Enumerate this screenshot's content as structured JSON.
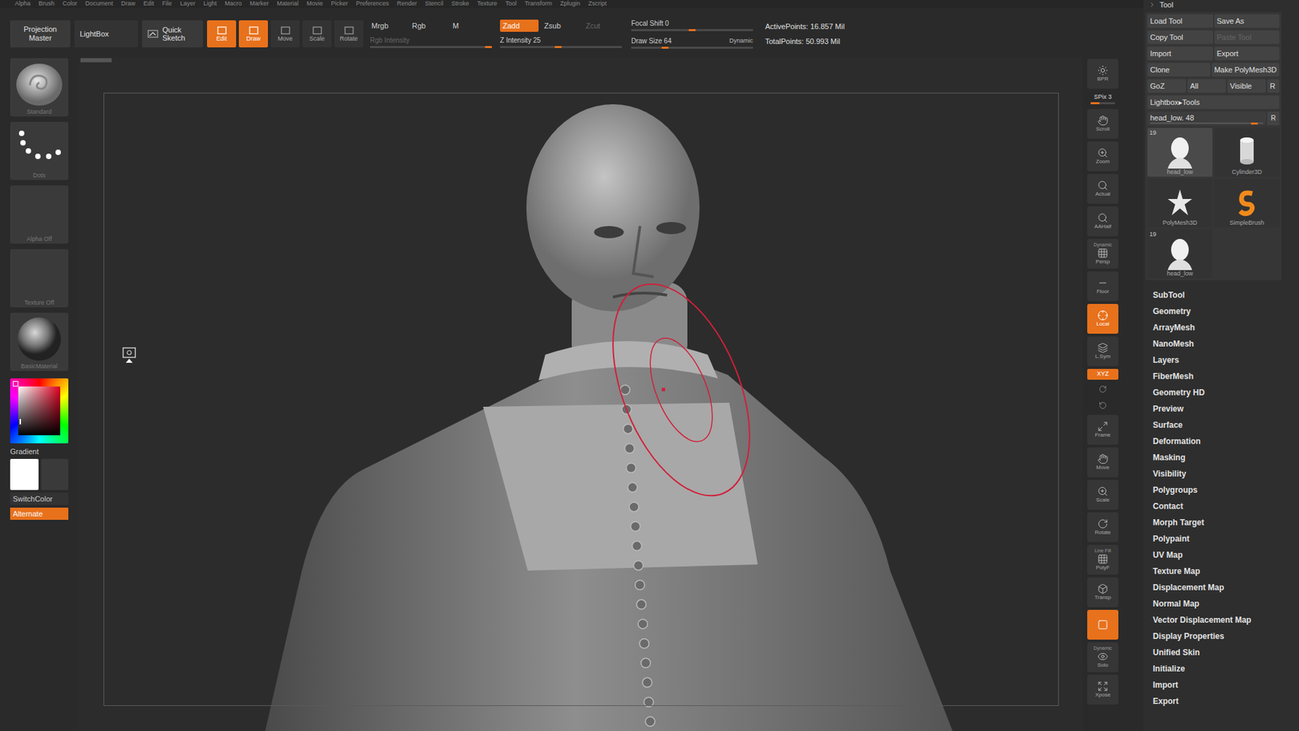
{
  "window": {
    "app": "ZBrush"
  },
  "menu_bar": [
    "Alpha",
    "Brush",
    "Color",
    "Document",
    "Draw",
    "Edit",
    "File",
    "Layer",
    "Light",
    "Macro",
    "Marker",
    "Material",
    "Movie",
    "Picker",
    "Preferences",
    "Render",
    "Stencil",
    "Stroke",
    "Texture",
    "Tool",
    "Transform",
    "Zplugin",
    "Zscript"
  ],
  "top_shelf": {
    "projection_master": [
      "Projection",
      "Master"
    ],
    "lightbox": "LightBox",
    "quick_sketch": [
      "Quick",
      "Sketch"
    ],
    "modes": [
      {
        "label": "Edit",
        "selected": true
      },
      {
        "label": "Draw",
        "selected": true
      },
      {
        "label": "Move",
        "selected": false
      },
      {
        "label": "Scale",
        "selected": false
      },
      {
        "label": "Rotate",
        "selected": false
      }
    ],
    "color_modes": [
      {
        "label": "Mrgb",
        "selected": false
      },
      {
        "label": "Rgb",
        "selected": false
      },
      {
        "label": "M",
        "selected": false
      }
    ],
    "rgb_intensity": {
      "label": "Rgb Intensity",
      "level": 0.97,
      "disabled": true
    },
    "z_modes": [
      {
        "label": "Zadd",
        "selected": true,
        "disabled": false
      },
      {
        "label": "Zsub",
        "selected": false,
        "disabled": false
      },
      {
        "label": "Zcut",
        "selected": false,
        "disabled": true
      }
    ],
    "z_intensity": {
      "label": "Z Intensity 25",
      "level": 0.48
    },
    "focal_shift": {
      "label": "Focal Shift 0",
      "level": 0.5
    },
    "draw_size": {
      "label": "Draw Size 64",
      "level": 0.28
    },
    "dynamic": "Dynamic",
    "stats": [
      "ActivePoints: 16.857 Mil",
      "TotalPoints: 50.993 Mil"
    ]
  },
  "left_shelf": {
    "brush": "Standard",
    "stroke": "Dots",
    "alpha": "Alpha Off",
    "texture": "Texture Off",
    "material": "BasicMaterial",
    "gradient": "Gradient",
    "switch_color": "SwitchColor",
    "alternate": {
      "label": "Alternate",
      "on": true
    },
    "main_color": "#ffffff",
    "secondary_color": "#3a3a3a"
  },
  "right_shelf": [
    {
      "kind": "button",
      "label": "BPR",
      "active": false
    },
    {
      "kind": "slider",
      "label": "SPix 3",
      "level": 0.35
    },
    {
      "kind": "button",
      "label": "Scroll",
      "active": false
    },
    {
      "kind": "button",
      "label": "Zoom",
      "active": false
    },
    {
      "kind": "button",
      "label": "Actual",
      "active": false
    },
    {
      "kind": "button",
      "label": "AAHalf",
      "active": false
    },
    {
      "kind": "button",
      "top": "Dynamic",
      "label": "Persp",
      "active": false
    },
    {
      "kind": "button",
      "label": "Floor",
      "active": false
    },
    {
      "kind": "button",
      "label": "Local",
      "active": true
    },
    {
      "kind": "button",
      "label": "L.Sym",
      "active": false
    },
    {
      "kind": "small",
      "label": "XYZ",
      "active": true
    },
    {
      "kind": "tiny",
      "active": false
    },
    {
      "kind": "tiny",
      "active": false
    },
    {
      "kind": "button",
      "label": "Frame",
      "active": false
    },
    {
      "kind": "button",
      "label": "Move",
      "active": false
    },
    {
      "kind": "button",
      "label": "Scale",
      "active": false
    },
    {
      "kind": "button",
      "label": "Rotate",
      "active": false
    },
    {
      "kind": "button",
      "top": "Line Fill",
      "label": "PolyF",
      "active": false
    },
    {
      "kind": "button",
      "label": "Transp",
      "active": false
    },
    {
      "kind": "button",
      "active": true
    },
    {
      "kind": "button",
      "top": "Dynamic",
      "label": "Solo",
      "active": false
    },
    {
      "kind": "button",
      "label": "Xpose",
      "active": false
    }
  ],
  "tool_panel": {
    "title": "Tool",
    "button_rows": [
      [
        {
          "label": "Load Tool",
          "disabled": false
        },
        {
          "label": "Save As",
          "disabled": false
        }
      ],
      [
        {
          "label": "Copy Tool",
          "disabled": false
        },
        {
          "label": "Paste Tool",
          "disabled": true
        }
      ],
      [
        {
          "label": "Import",
          "disabled": false
        },
        {
          "label": "Export",
          "disabled": false
        }
      ],
      [
        {
          "label": "Clone",
          "disabled": false
        },
        {
          "label": "Make PolyMesh3D",
          "disabled": false
        }
      ],
      [
        {
          "label": "GoZ",
          "disabled": false
        },
        {
          "label": "All",
          "disabled": false
        },
        {
          "label": "Visible",
          "disabled": false
        },
        {
          "label": "R",
          "disabled": false
        }
      ]
    ],
    "lightbox_tools": "Lightbox▸Tools",
    "current_tool": {
      "label": "head_low. 48",
      "level": 0.92,
      "reset": "R"
    },
    "thumbnails": [
      {
        "label": "head_low",
        "badge": "19",
        "selected": true
      },
      {
        "label": "Cylinder3D",
        "selected": false
      },
      {
        "label": "PolyMesh3D",
        "selected": false
      },
      {
        "label": "SimpleBrush",
        "selected": false
      },
      {
        "label": "head_low",
        "badge": "19",
        "selected": false
      }
    ],
    "menu": [
      "SubTool",
      "Geometry",
      "ArrayMesh",
      "NanoMesh",
      "Layers",
      "FiberMesh",
      "Geometry HD",
      "Preview",
      "Surface",
      "Deformation",
      "Masking",
      "Visibility",
      "Polygroups",
      "Contact",
      "Morph Target",
      "Polypaint",
      "UV Map",
      "Texture Map",
      "Displacement Map",
      "Normal Map",
      "Vector Displacement Map",
      "Display Properties",
      "Unified Skin",
      "Initialize",
      "Import",
      "Export"
    ]
  }
}
